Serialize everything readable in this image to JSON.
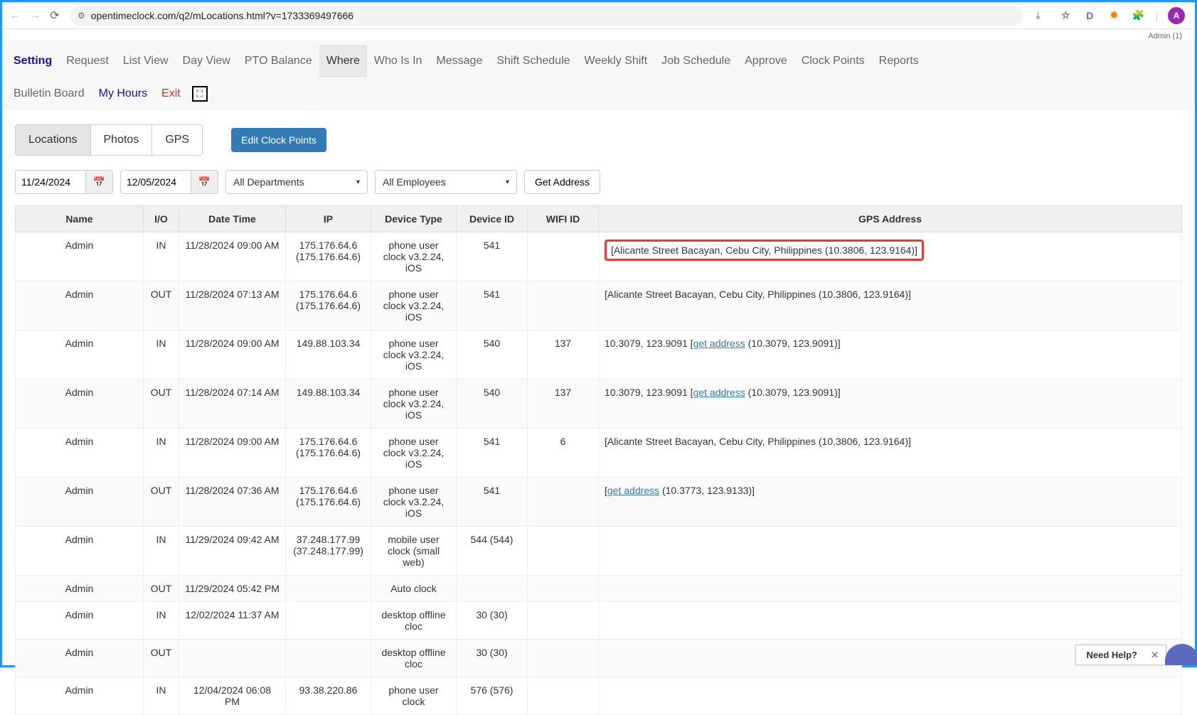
{
  "browser": {
    "url": "opentimeclock.com/q2/mLocations.html?v=1733369497666",
    "avatar_letter": "A",
    "ext_d": "D"
  },
  "admin_label": "Admin (1)",
  "nav": {
    "setting": "Setting",
    "request": "Request",
    "list_view": "List View",
    "day_view": "Day View",
    "pto": "PTO Balance",
    "where": "Where",
    "who": "Who Is In",
    "message": "Message",
    "shift": "Shift Schedule",
    "weekly": "Weekly Shift",
    "job": "Job Schedule",
    "approve": "Approve",
    "clock": "Clock Points",
    "reports": "Reports",
    "bulletin": "Bulletin Board",
    "myhours": "My Hours",
    "exit": "Exit"
  },
  "subtabs": {
    "locations": "Locations",
    "photos": "Photos",
    "gps": "GPS"
  },
  "edit_btn": "Edit Clock Points",
  "filters": {
    "date_from": "11/24/2024",
    "date_to": "12/05/2024",
    "dept": "All Departments",
    "emp": "All Employees",
    "get_addr": "Get Address"
  },
  "table": {
    "headers": {
      "name": "Name",
      "io": "I/O",
      "dt": "Date Time",
      "ip": "IP",
      "dev": "Device Type",
      "did": "Device ID",
      "wifi": "WIFI ID",
      "gps": "GPS Address"
    },
    "rows": [
      {
        "name": "Admin",
        "io": "IN",
        "dt": "11/28/2024 09:00 AM",
        "ip": "175.176.64.6 (175.176.64.6)",
        "dev": "phone user clock v3.2.24, iOS",
        "did": "541",
        "wifi": "",
        "gps_pre": "[Alicante Street Bacayan, Cebu City, Philippines (10.3806, 123.9164)]",
        "gps_link": "",
        "gps_post": "",
        "highlight": true
      },
      {
        "name": "Admin",
        "io": "OUT",
        "dt": "11/28/2024 07:13 AM",
        "ip": "175.176.64.6 (175.176.64.6)",
        "dev": "phone user clock v3.2.24, iOS",
        "did": "541",
        "wifi": "",
        "gps_pre": "[Alicante Street Bacayan, Cebu City, Philippines (10.3806, 123.9164)]",
        "gps_link": "",
        "gps_post": ""
      },
      {
        "name": "Admin",
        "io": "IN",
        "dt": "11/28/2024 09:00 AM",
        "ip": "149.88.103.34",
        "dev": "phone user clock v3.2.24, iOS",
        "did": "540",
        "wifi": "137",
        "gps_pre": "10.3079, 123.9091 [",
        "gps_link": "get address",
        "gps_post": " (10.3079, 123.9091)]"
      },
      {
        "name": "Admin",
        "io": "OUT",
        "dt": "11/28/2024 07:14 AM",
        "ip": "149.88.103.34",
        "dev": "phone user clock v3.2.24, iOS",
        "did": "540",
        "wifi": "137",
        "gps_pre": "10.3079, 123.9091 [",
        "gps_link": "get address",
        "gps_post": " (10.3079, 123.9091)]"
      },
      {
        "name": "Admin",
        "io": "IN",
        "dt": "11/28/2024 09:00 AM",
        "ip": "175.176.64.6 (175.176.64.6)",
        "dev": "phone user clock v3.2.24, iOS",
        "did": "541",
        "wifi": "6",
        "gps_pre": "[Alicante Street Bacayan, Cebu City, Philippines (10.3806, 123.9164)]",
        "gps_link": "",
        "gps_post": ""
      },
      {
        "name": "Admin",
        "io": "OUT",
        "dt": "11/28/2024 07:36 AM",
        "ip": "175.176.64.6 (175.176.64.6)",
        "dev": "phone user clock v3.2.24, iOS",
        "did": "541",
        "wifi": "",
        "gps_pre": "[",
        "gps_link": "get address",
        "gps_post": " (10.3773, 123.9133)]"
      },
      {
        "name": "Admin",
        "io": "IN",
        "dt": "11/29/2024 09:42 AM",
        "ip": "37.248.177.99 (37.248.177.99)",
        "dev": "mobile user clock (small web)",
        "did": "544 (544)",
        "wifi": "",
        "gps_pre": "",
        "gps_link": "",
        "gps_post": ""
      },
      {
        "name": "Admin",
        "io": "OUT",
        "dt": "11/29/2024 05:42 PM",
        "ip": "",
        "dev": "Auto clock",
        "did": "",
        "wifi": "",
        "gps_pre": "",
        "gps_link": "",
        "gps_post": ""
      },
      {
        "name": "Admin",
        "io": "IN",
        "dt": "12/02/2024 11:37 AM",
        "ip": "",
        "dev": "desktop offline cloc",
        "did": "30 (30)",
        "wifi": "",
        "gps_pre": "",
        "gps_link": "",
        "gps_post": ""
      },
      {
        "name": "Admin",
        "io": "OUT",
        "dt": "",
        "ip": "",
        "dev": "desktop offline cloc",
        "did": "30 (30)",
        "wifi": "",
        "gps_pre": "",
        "gps_link": "",
        "gps_post": ""
      },
      {
        "name": "Admin",
        "io": "IN",
        "dt": "12/04/2024 06:08 PM",
        "ip": "93.38.220.86",
        "dev": "phone user clock",
        "did": "576 (576)",
        "wifi": "",
        "gps_pre": "",
        "gps_link": "",
        "gps_post": ""
      }
    ]
  },
  "help": "Need Help?"
}
